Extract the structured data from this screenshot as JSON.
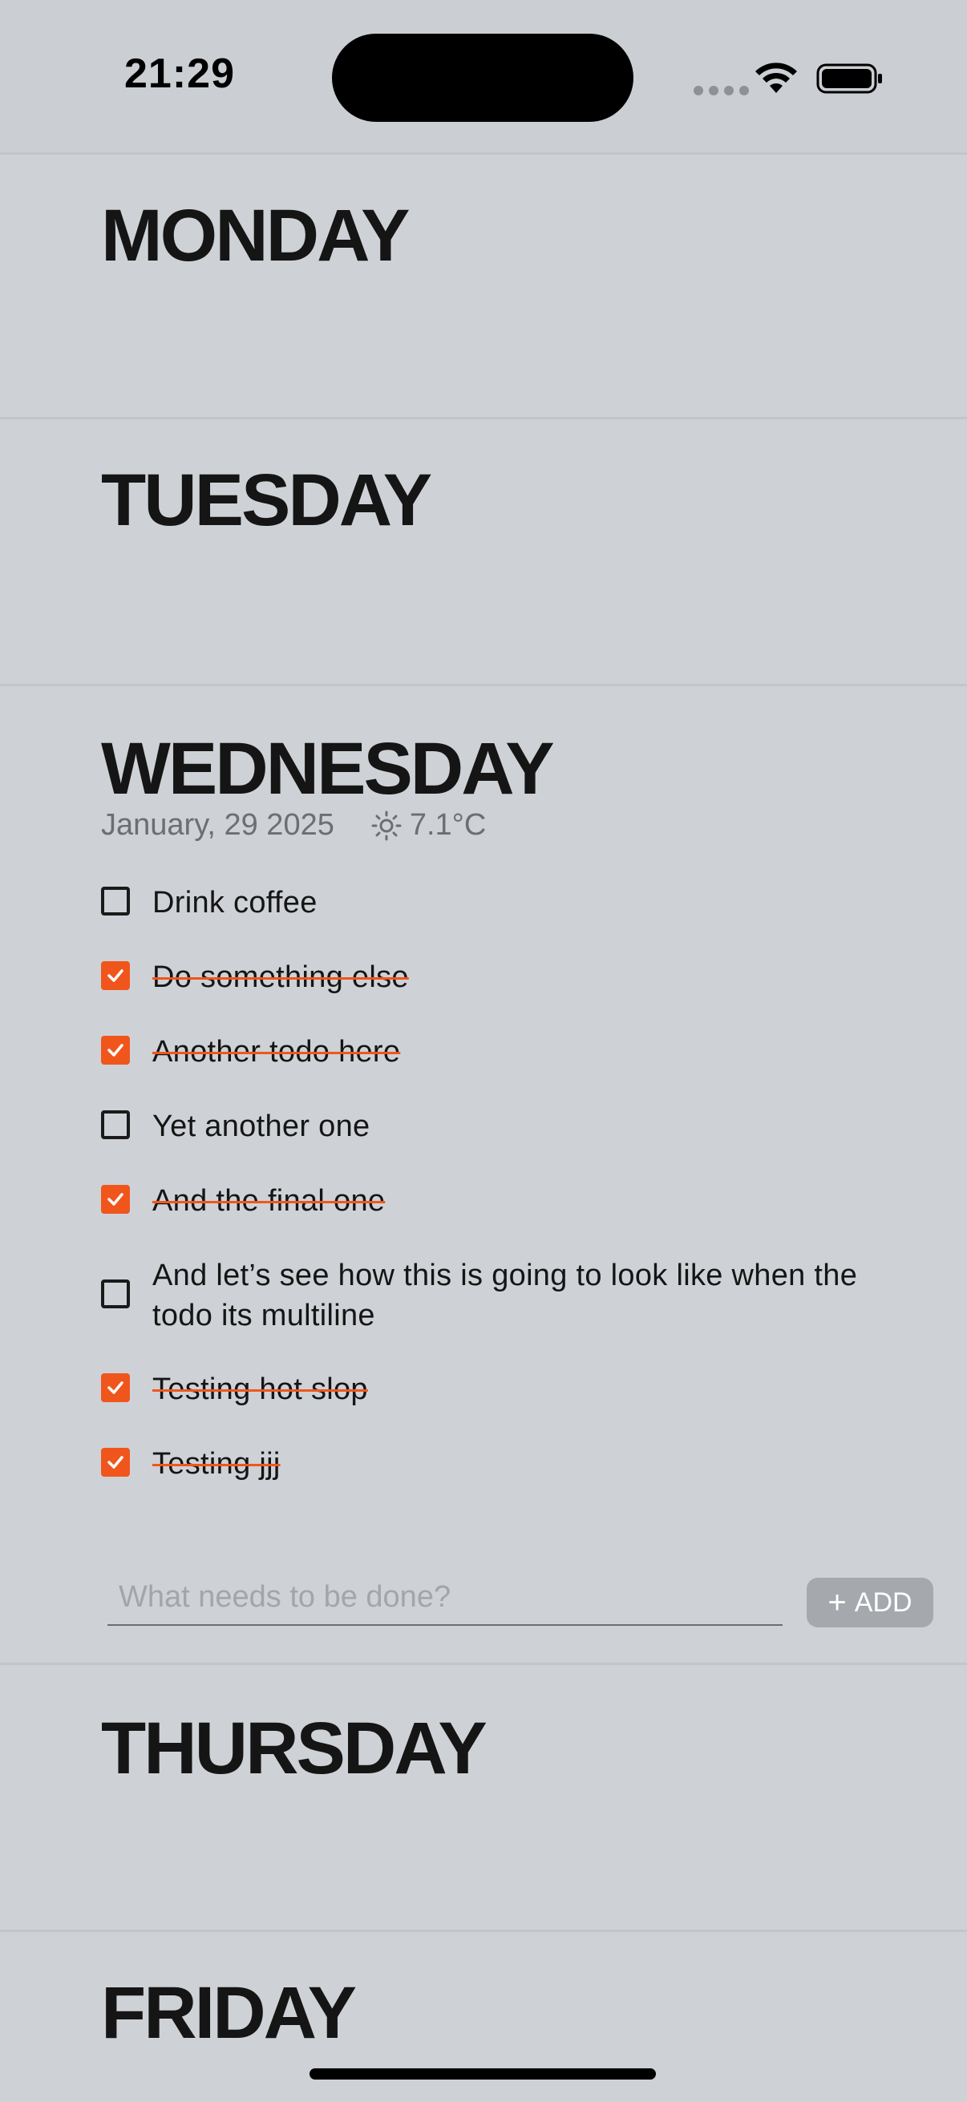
{
  "status_bar": {
    "time": "21:29",
    "icons": [
      "signal-dots-icon",
      "wifi-icon",
      "battery-icon"
    ]
  },
  "days": {
    "monday": "MONDAY",
    "tuesday": "TUESDAY",
    "wednesday": "WEDNESDAY",
    "thursday": "THURSDAY",
    "friday": "FRIDAY"
  },
  "wednesday_meta": {
    "date": "January, 29 2025",
    "weather_icon": "sun-icon",
    "temperature": "7.1°C"
  },
  "todos": [
    {
      "text": "Drink coffee",
      "done": false
    },
    {
      "text": "Do something else",
      "done": true
    },
    {
      "text": "Another todo here",
      "done": true
    },
    {
      "text": "Yet another one",
      "done": false
    },
    {
      "text": "And the final one",
      "done": true
    },
    {
      "text": "And let’s see how this is going to look like when the todo its multiline",
      "done": false
    },
    {
      "text": "Testing hot slop",
      "done": true
    },
    {
      "text": "Testing jjj",
      "done": true
    }
  ],
  "new_todo": {
    "placeholder": "What needs to be done?",
    "value": "",
    "add_label": "ADD"
  },
  "colors": {
    "accent": "#f0561c",
    "background": "#ced2d6",
    "text": "#151515",
    "muted": "#6b6f73"
  }
}
